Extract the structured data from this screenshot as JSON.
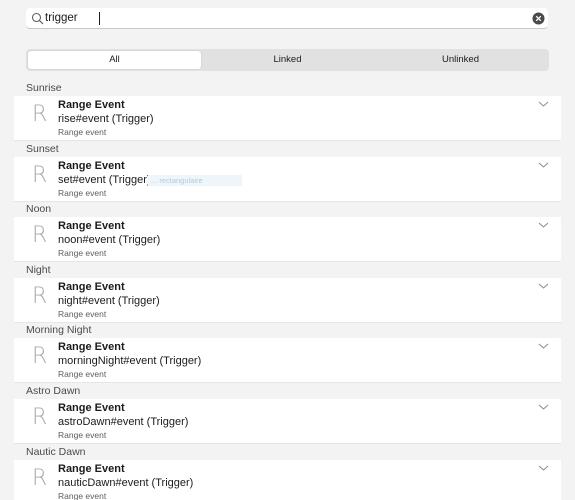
{
  "search": {
    "value": "trigger",
    "placeholder": ""
  },
  "filter_tabs": [
    {
      "label": "All",
      "active": true
    },
    {
      "label": "Linked",
      "active": false
    },
    {
      "label": "Unlinked",
      "active": false
    }
  ],
  "groups": [
    {
      "header": "Sunrise",
      "glyph": "R",
      "title": "Range Event",
      "expression": "rise#event (Trigger)",
      "subtitle": "Range event"
    },
    {
      "header": "Sunset",
      "glyph": "R",
      "title": "Range Event",
      "expression": "set#event (Trigger)",
      "subtitle": "Range event"
    },
    {
      "header": "Noon",
      "glyph": "R",
      "title": "Range Event",
      "expression": "noon#event (Trigger)",
      "subtitle": "Range event"
    },
    {
      "header": "Night",
      "glyph": "R",
      "title": "Range Event",
      "expression": "night#event (Trigger)",
      "subtitle": "Range event"
    },
    {
      "header": "Morning Night",
      "glyph": "R",
      "title": "Range Event",
      "expression": "morningNight#event (Trigger)",
      "subtitle": "Range event"
    },
    {
      "header": "Astro Dawn",
      "glyph": "R",
      "title": "Range Event",
      "expression": "astroDawn#event (Trigger)",
      "subtitle": "Range event"
    },
    {
      "header": "Nautic Dawn",
      "glyph": "R",
      "title": "Range Event",
      "expression": "nauticDawn#event (Trigger)",
      "subtitle": "Range event"
    }
  ],
  "tooltip_ghost": "... rectangulaire",
  "colors": {
    "background": "#f3f3f3",
    "card": "#ffffff",
    "segment_track": "#e1e1e1"
  }
}
